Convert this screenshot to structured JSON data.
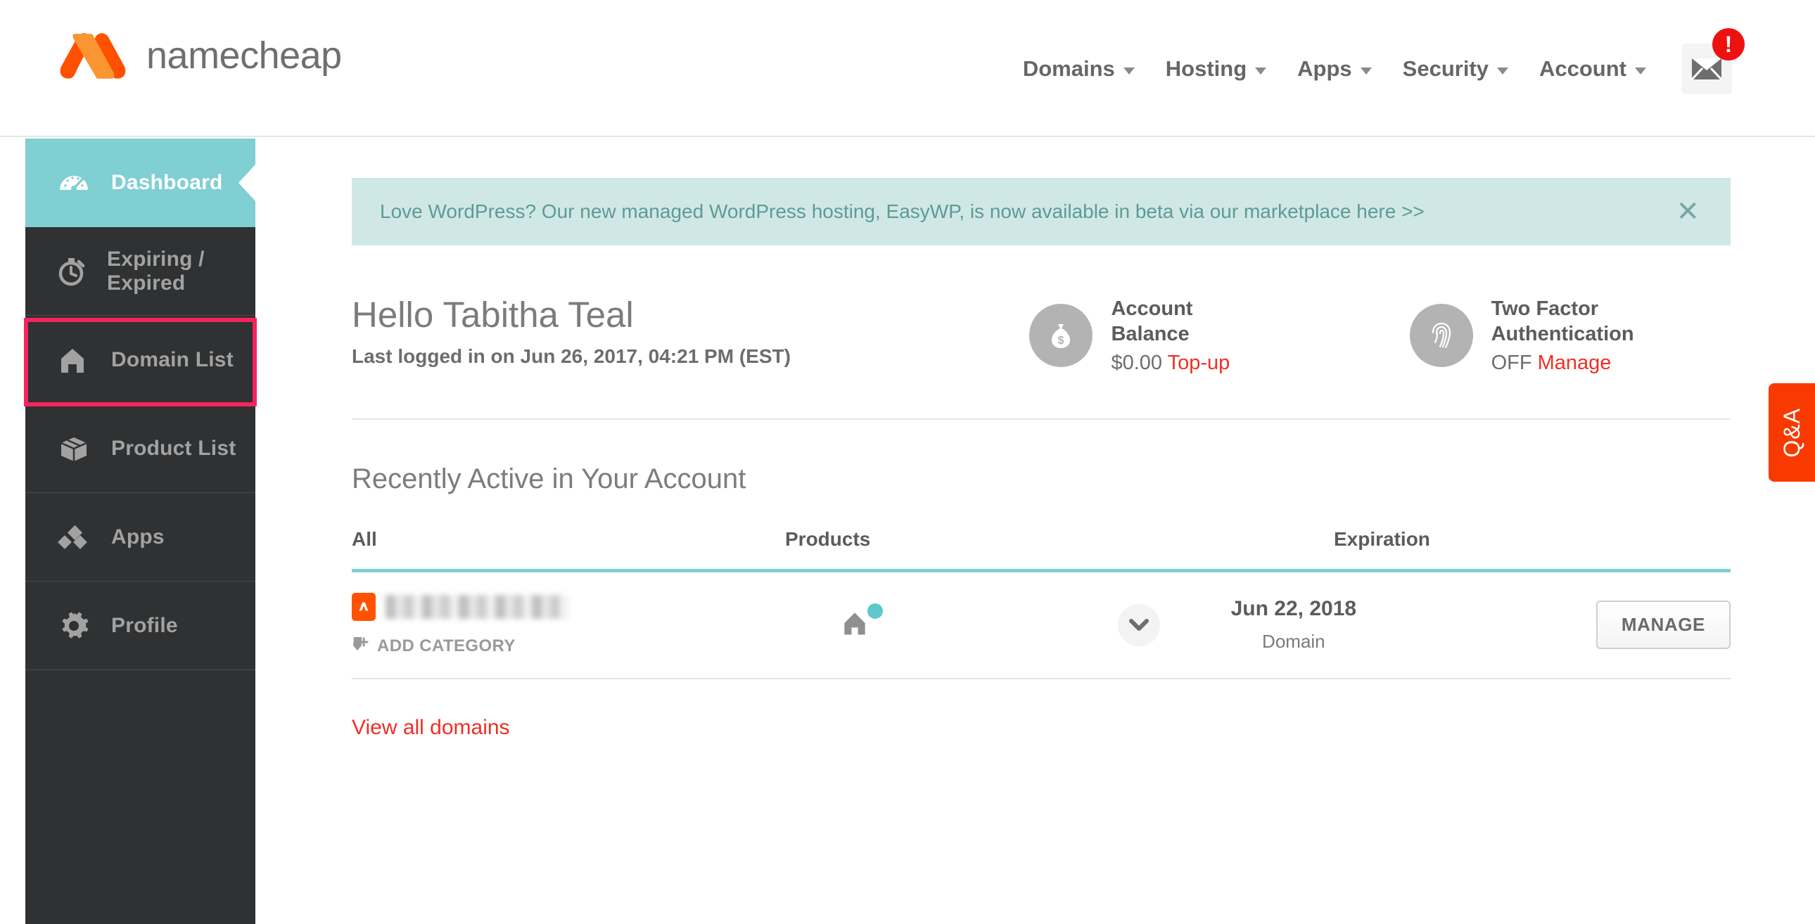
{
  "header": {
    "logo_text": "namecheap",
    "logo_icon": "namecheap-logo-icon",
    "nav_items": [
      {
        "label": "Domains",
        "icon": "chevron-down-icon"
      },
      {
        "label": "Hosting",
        "icon": "chevron-down-icon"
      },
      {
        "label": "Apps",
        "icon": "chevron-down-icon"
      },
      {
        "label": "Security",
        "icon": "chevron-down-icon"
      },
      {
        "label": "Account",
        "icon": "chevron-down-icon"
      }
    ],
    "mail_icon": "envelope-icon",
    "mail_badge": "!"
  },
  "sidebar": {
    "items": [
      {
        "label": "Dashboard",
        "icon": "speedometer-icon",
        "active": true
      },
      {
        "label": "Expiring / Expired",
        "icon": "stopwatch-icon",
        "active": false
      },
      {
        "label": "Domain List",
        "icon": "house-icon",
        "active": false
      },
      {
        "label": "Product List",
        "icon": "box-icon",
        "active": false
      },
      {
        "label": "Apps",
        "icon": "diamonds-icon",
        "active": false
      },
      {
        "label": "Profile",
        "icon": "gear-icon",
        "active": false
      }
    ],
    "highlight_target": "Domain List",
    "highlight_color": "#f5245e"
  },
  "banner": {
    "message": "Love WordPress? Our new managed WordPress hosting, EasyWP, is now available in beta via our marketplace here >>",
    "close_icon": "close-icon",
    "background": "#cfe8e6",
    "text_color": "#5e9a98"
  },
  "greeting": {
    "title": "Hello Tabitha Teal",
    "subtitle": "Last logged in on Jun 26, 2017, 04:21 PM (EST)"
  },
  "stats": [
    {
      "icon": "money-bag-icon",
      "title": "Account Balance",
      "value": "$0.00",
      "action": "Top-up"
    },
    {
      "icon": "fingerprint-icon",
      "title": "Two Factor Authentication",
      "value": "OFF",
      "action": "Manage"
    }
  ],
  "recent": {
    "section_title": "Recently Active in Your Account",
    "columns": {
      "all": "All",
      "products": "Products",
      "expiration": "Expiration"
    },
    "rows": [
      {
        "domain_icon": "namecheap-chip-icon",
        "domain_name": "",
        "add_category_icon": "tag-plus-icon",
        "add_category": "ADD CATEGORY",
        "product_icon": "house-icon",
        "product_status_dot": "#5ec8cc",
        "expand_icon": "chevron-down-icon",
        "expiration_date": "Jun 22, 2018",
        "expiration_type": "Domain",
        "manage_label": "MANAGE"
      }
    ],
    "view_all": "View all domains"
  },
  "qa_tab": {
    "label": "Q&A",
    "color": "#f93a00"
  }
}
